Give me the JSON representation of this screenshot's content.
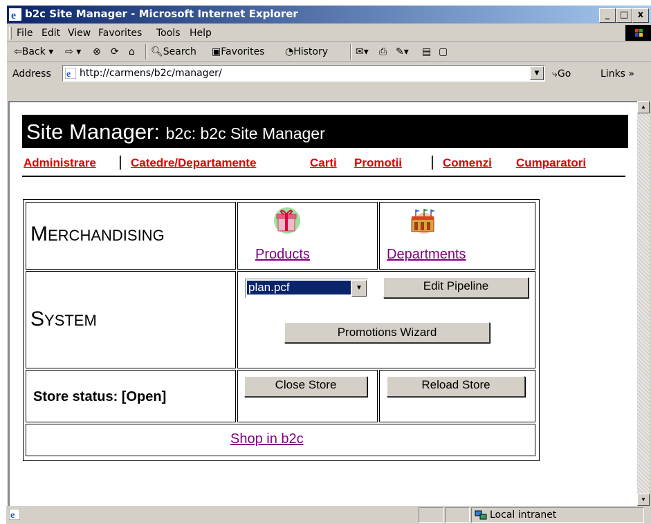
{
  "window": {
    "title": "b2c Site Manager - Microsoft Internet Explorer",
    "controls": {
      "minimize": "_",
      "maximize": "□",
      "close": "x"
    }
  },
  "menu": [
    "File",
    "Edit",
    "View",
    "Favorites",
    "Tools",
    "Help"
  ],
  "toolbar": {
    "back": "Back",
    "search": "Search",
    "favorites": "Favorites",
    "history": "History"
  },
  "address": {
    "label": "Address",
    "url": "http://carmens/b2c/manager/",
    "go": "Go",
    "links": "Links"
  },
  "page": {
    "header_title": "Site Manager:",
    "header_subtitle": "b2c: b2c Site Manager",
    "nav": [
      "Administrare",
      "Catedre/Departamente",
      "Carti",
      "Promotii",
      "Comenzi",
      "Cumparatori"
    ],
    "nav_separator": "|",
    "merchandising_first": "M",
    "merchandising_rest": "ERCHANDISING",
    "products_label": "Products",
    "departments_label": "Departments",
    "system_first": "S",
    "system_rest": "YSTEM",
    "pipeline_select": {
      "selected": "plan.pcf"
    },
    "edit_pipeline_label": "Edit Pipeline",
    "promotions_wizard_label": "Promotions Wizard",
    "store_status": "Store status: [Open]",
    "close_store_label": "Close Store",
    "reload_store_label": "Reload Store",
    "shop_link": "Shop in b2c"
  },
  "status": {
    "zone": "Local intranet"
  },
  "colors": {
    "titlebar_start": "#0a246a",
    "nav_link": "#e00000",
    "visited_link": "#800080"
  }
}
